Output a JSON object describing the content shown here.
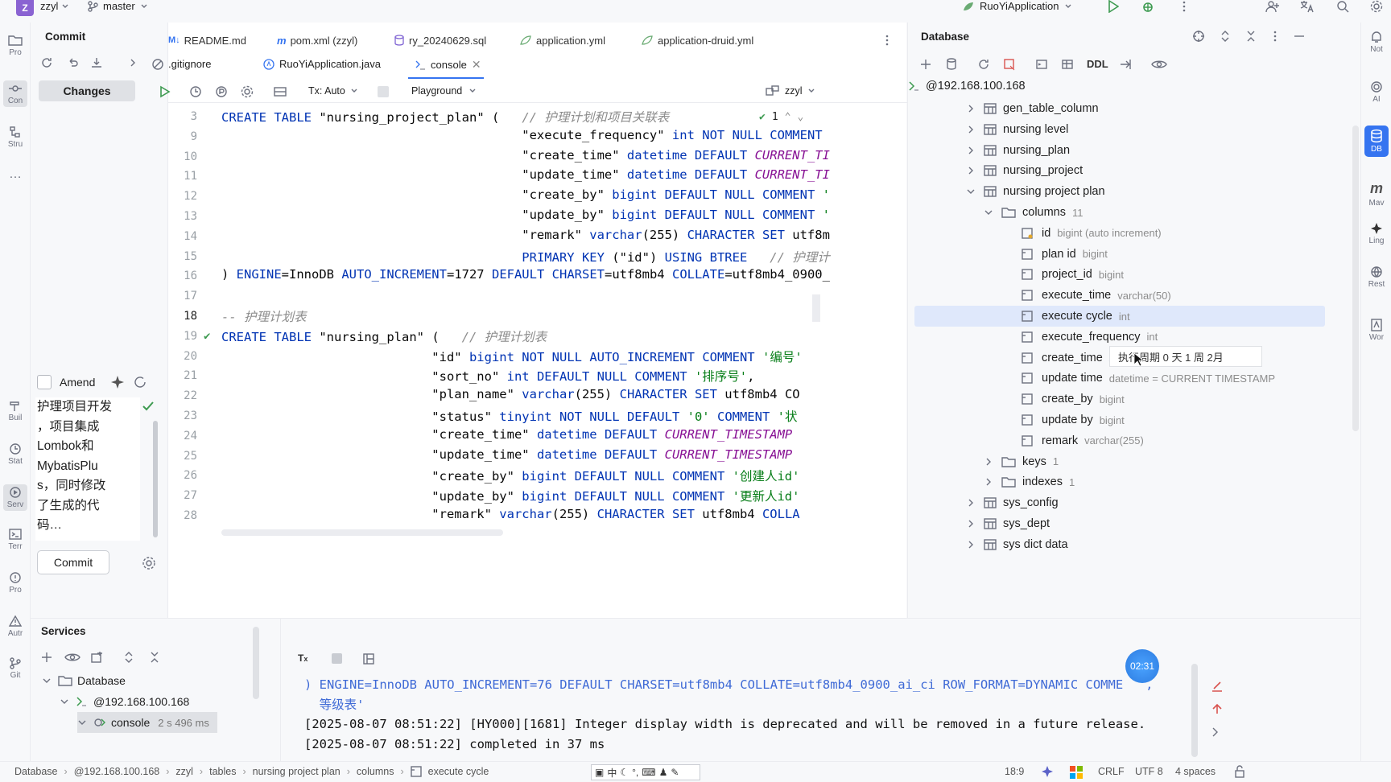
{
  "topbar": {
    "project_letter": "Z",
    "project_name": "zzyl",
    "branch": "master",
    "run_config": "RuoYiApplication"
  },
  "left_strip": [
    "Pro",
    "Con",
    "Stru",
    "Buil",
    "Stat",
    "Serv",
    "Terr",
    "Pro",
    "Autr",
    "Git"
  ],
  "right_strip": [
    "Not",
    "AI",
    "DB",
    "Mav",
    "Ling",
    "Rest",
    "Wor"
  ],
  "commit": {
    "title": "Commit",
    "changes_tab": "Changes",
    "amend_label": "Amend",
    "message_lines": [
      "护理项目开发",
      "，项目集成",
      "Lombok和",
      "MybatisPlu",
      "s，同时修改",
      "了生成的代",
      "码…"
    ],
    "commit_button": "Commit"
  },
  "editor_tabs_row1": [
    "README.md",
    "pom.xml (zzyl)",
    "ry_20240629.sql",
    "application.yml",
    "application-druid.yml"
  ],
  "editor_tabs_row2": [
    ".gitignore",
    "RuoYiApplication.java",
    "console"
  ],
  "editor_toolbar": {
    "tx": "Tx: Auto",
    "playground": "Playground",
    "schema": "zzyl"
  },
  "code_lines": [
    {
      "n": "3",
      "text": "CREATE TABLE \"nursing_project_plan\" (   // 护理计划和项目关联表"
    },
    {
      "n": "9",
      "text": "                                        \"execute_frequency\" int NOT NULL COMMENT"
    },
    {
      "n": "10",
      "text": "                                        \"create_time\" datetime DEFAULT CURRENT_TI"
    },
    {
      "n": "11",
      "text": "                                        \"update_time\" datetime DEFAULT CURRENT_TI"
    },
    {
      "n": "12",
      "text": "                                        \"create_by\" bigint DEFAULT NULL COMMENT '"
    },
    {
      "n": "13",
      "text": "                                        \"update_by\" bigint DEFAULT NULL COMMENT '"
    },
    {
      "n": "14",
      "text": "                                        \"remark\" varchar(255) CHARACTER SET utf8m"
    },
    {
      "n": "15",
      "text": "                                        PRIMARY KEY (\"id\") USING BTREE   // 护理计"
    },
    {
      "n": "16",
      "text": ") ENGINE=InnoDB AUTO_INCREMENT=1727 DEFAULT CHARSET=utf8mb4 COLLATE=utf8mb4_0900_"
    },
    {
      "n": "17",
      "text": ""
    },
    {
      "n": "18",
      "text": "-- 护理计划表"
    },
    {
      "n": "19",
      "text": "CREATE TABLE \"nursing_plan\" (   // 护理计划表"
    },
    {
      "n": "20",
      "text": "                            \"id\" bigint NOT NULL AUTO_INCREMENT COMMENT '编号'"
    },
    {
      "n": "21",
      "text": "                            \"sort_no\" int DEFAULT NULL COMMENT '排序号',"
    },
    {
      "n": "22",
      "text": "                            \"plan_name\" varchar(255) CHARACTER SET utf8mb4 CO"
    },
    {
      "n": "23",
      "text": "                            \"status\" tinyint NOT NULL DEFAULT '0' COMMENT '状"
    },
    {
      "n": "24",
      "text": "                            \"create_time\" datetime DEFAULT CURRENT_TIMESTAMP"
    },
    {
      "n": "25",
      "text": "                            \"update_time\" datetime DEFAULT CURRENT_TIMESTAMP"
    },
    {
      "n": "26",
      "text": "                            \"create_by\" bigint DEFAULT NULL COMMENT '创建人id'"
    },
    {
      "n": "27",
      "text": "                            \"update_by\" bigint DEFAULT NULL COMMENT '更新人id'"
    },
    {
      "n": "28",
      "text": "                            \"remark\" varchar(255) CHARACTER SET utf8mb4 COLLA"
    }
  ],
  "inspection": "1",
  "database": {
    "title": "Database",
    "ddl": "DDL",
    "host": "@192.168.100.168",
    "tables_top": [
      "gen_table_column",
      "nursing level",
      "nursing_plan",
      "nursing_project",
      "nursing project plan"
    ],
    "columns_label": "columns",
    "columns_count": "11",
    "columns": [
      {
        "name": "id",
        "type": "bigint (auto increment)"
      },
      {
        "name": "plan id",
        "type": "bigint"
      },
      {
        "name": "project_id",
        "type": "bigint"
      },
      {
        "name": "execute_time",
        "type": "varchar(50)"
      },
      {
        "name": "execute cycle",
        "type": "int"
      },
      {
        "name": "execute_frequency",
        "type": "int"
      },
      {
        "name": "create_time",
        "type": "AMP"
      },
      {
        "name": "update time",
        "type": "datetime = CURRENT TIMESTAMP"
      },
      {
        "name": "create_by",
        "type": "bigint"
      },
      {
        "name": "update by",
        "type": "bigint"
      },
      {
        "name": "remark",
        "type": "varchar(255)"
      }
    ],
    "keys_label": "keys",
    "keys_count": "1",
    "indexes_label": "indexes",
    "indexes_count": "1",
    "tables_bottom": [
      "sys_config",
      "sys_dept",
      "sys dict data"
    ],
    "tooltip": "执行周期 0 天 1 周 2月"
  },
  "services": {
    "title": "Services",
    "tree": [
      {
        "label": "Database"
      },
      {
        "label": "@192.168.100.168"
      },
      {
        "label": "console",
        "time": "2 s 496 ms"
      }
    ],
    "output_lines": [
      ") ENGINE=InnoDB AUTO_INCREMENT=76 DEFAULT CHARSET=utf8mb4 COLLATE=utf8mb4_0900_ai_ci ROW_FORMAT=DYNAMIC COMME   ,   ",
      "  等级表'",
      "[2025-08-07 08:51:22] [HY000][1681] Integer display width is deprecated and will be removed in a future release.",
      "[2025-08-07 08:51:22] completed in 37 ms"
    ],
    "timer": "02:31"
  },
  "statusbar": {
    "breadcrumbs": [
      "Database",
      "@192.168.100.168",
      "zzyl",
      "tables",
      "nursing project plan",
      "columns",
      "execute cycle"
    ],
    "position": "18:9",
    "line_sep": "CRLF",
    "encoding": "UTF 8",
    "indent": "4 spaces"
  },
  "colors": {
    "accent": "#3574f0",
    "selection": "#dfe8fb",
    "badge": "#8a63d2"
  }
}
